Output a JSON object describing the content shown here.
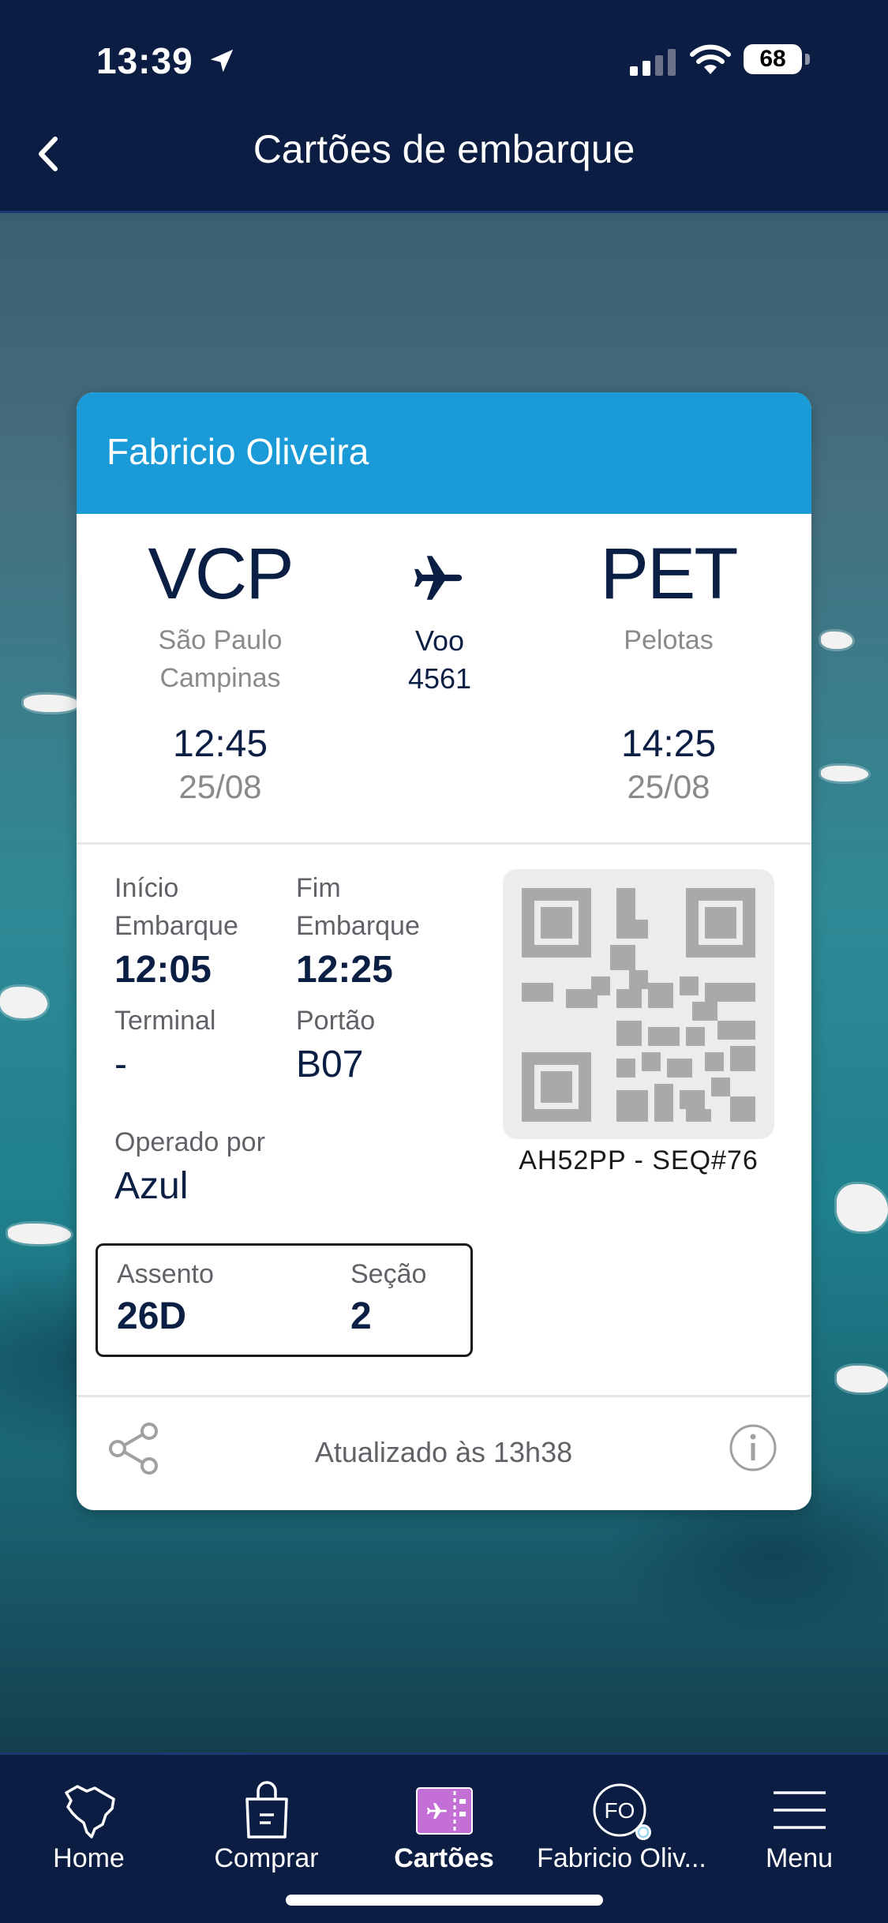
{
  "status_bar": {
    "time": "13:39",
    "battery": "68"
  },
  "header": {
    "title": "Cartões de embarque"
  },
  "card": {
    "passenger_name": "Fabricio Oliveira",
    "origin": {
      "code": "VCP",
      "city_line1": "São Paulo",
      "city_line2": "Campinas",
      "time": "12:45",
      "date": "25/08"
    },
    "destination": {
      "code": "PET",
      "city_line1": "Pelotas",
      "time": "14:25",
      "date": "25/08"
    },
    "flight": {
      "label": "Voo",
      "number": "4561"
    },
    "boarding_start": {
      "label_line1": "Início",
      "label_line2": "Embarque",
      "value": "12:05"
    },
    "boarding_end": {
      "label_line1": "Fim",
      "label_line2": "Embarque",
      "value": "12:25"
    },
    "terminal": {
      "label": "Terminal",
      "value": "-"
    },
    "gate": {
      "label": "Portão",
      "value": "B07"
    },
    "operator": {
      "label": "Operado por",
      "value": "Azul"
    },
    "seat": {
      "label": "Assento",
      "value": "26D"
    },
    "section": {
      "label": "Seção",
      "value": "2"
    },
    "locator": "AH52PP - SEQ#76",
    "updated": "Atualizado às 13h38"
  },
  "tabbar": {
    "tabs": [
      {
        "label": "Home",
        "icon": "brazil-map-icon"
      },
      {
        "label": "Comprar",
        "icon": "shopping-bag-icon"
      },
      {
        "label": "Cartões",
        "icon": "boarding-pass-icon",
        "active": true
      },
      {
        "label": "Fabricio Oliv...",
        "icon": "avatar-icon",
        "initials": "FO"
      },
      {
        "label": "Menu",
        "icon": "hamburger-icon"
      }
    ]
  },
  "colors": {
    "navy": "#0c1d43",
    "accent_blue": "#1a9ad7",
    "active_tab_icon": "#c46fd6"
  }
}
